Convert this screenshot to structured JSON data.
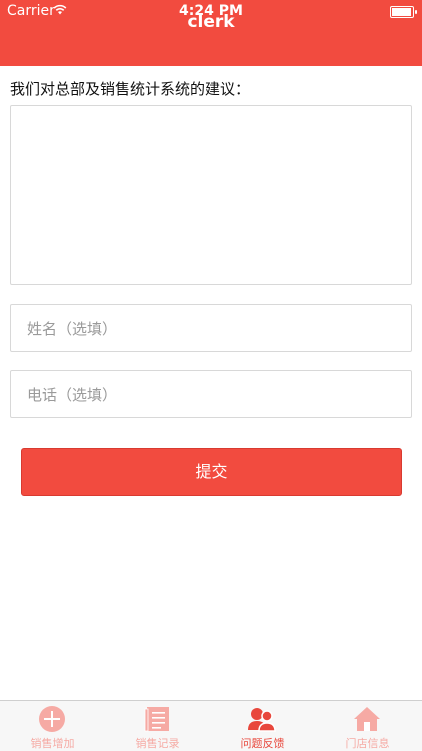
{
  "status_bar": {
    "carrier": "Carrier",
    "time": "4:24 PM"
  },
  "nav": {
    "title": "clerk"
  },
  "form": {
    "prompt": "我们对总部及销售统计系统的建议：",
    "name_placeholder": "姓名（选填）",
    "phone_placeholder": "电话（选填）",
    "submit_label": "提交"
  },
  "tabs": [
    {
      "label": "销售增加",
      "icon": "plus-circle-icon"
    },
    {
      "label": "销售记录",
      "icon": "record-book-icon"
    },
    {
      "label": "问题反馈",
      "icon": "feedback-people-icon",
      "active": true
    },
    {
      "label": "门店信息",
      "icon": "store-house-icon"
    }
  ],
  "colors": {
    "accent": "#f24b3f",
    "tab_inactive": "#f6aaa4",
    "tab_active": "#e8473c"
  }
}
